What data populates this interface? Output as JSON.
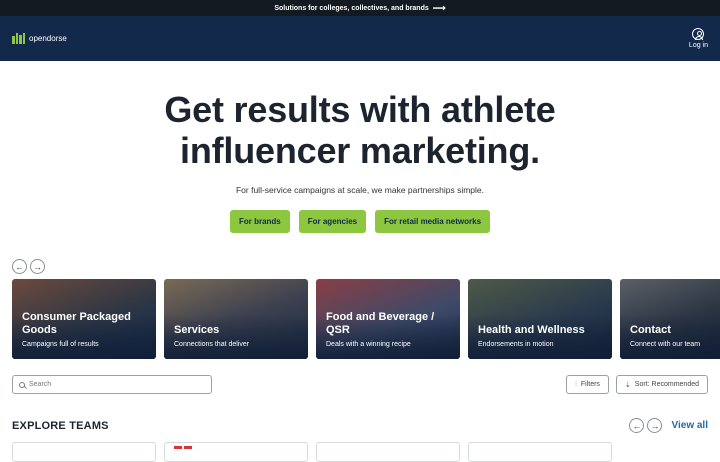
{
  "topbar": {
    "text": "Solutions for colleges, collectives, and brands",
    "arrow_icon": "arrow-right-icon"
  },
  "nav": {
    "logo_text": "opendorse",
    "login_label": "Log in"
  },
  "hero": {
    "headline_line1": "Get results with athlete",
    "headline_line2": "influencer marketing.",
    "subtitle": "For full-service campaigns at scale, we make partnerships simple.",
    "ctas": [
      "For brands",
      "For agencies",
      "For retail media networks"
    ]
  },
  "carousel": {
    "prev_icon": "arrow-left-icon",
    "next_icon": "arrow-right-icon",
    "cards": [
      {
        "title": "Consumer Packaged Goods",
        "subtitle": "Campaigns full of results"
      },
      {
        "title": "Services",
        "subtitle": "Connections that deliver"
      },
      {
        "title": "Food and Beverage / QSR",
        "subtitle": "Deals with a winning recipe"
      },
      {
        "title": "Health and Wellness",
        "subtitle": "Endorsements in motion"
      },
      {
        "title": "Contact",
        "subtitle": "Connect with our team"
      }
    ]
  },
  "search": {
    "placeholder": "Search",
    "filters_label": "Filters",
    "sort_label": "Sort: Recommended"
  },
  "explore": {
    "heading": "EXPLORE TEAMS",
    "view_all": "View all"
  },
  "colors": {
    "navy": "#13294b",
    "green": "#8dc63f",
    "link": "#1f6aa5"
  }
}
